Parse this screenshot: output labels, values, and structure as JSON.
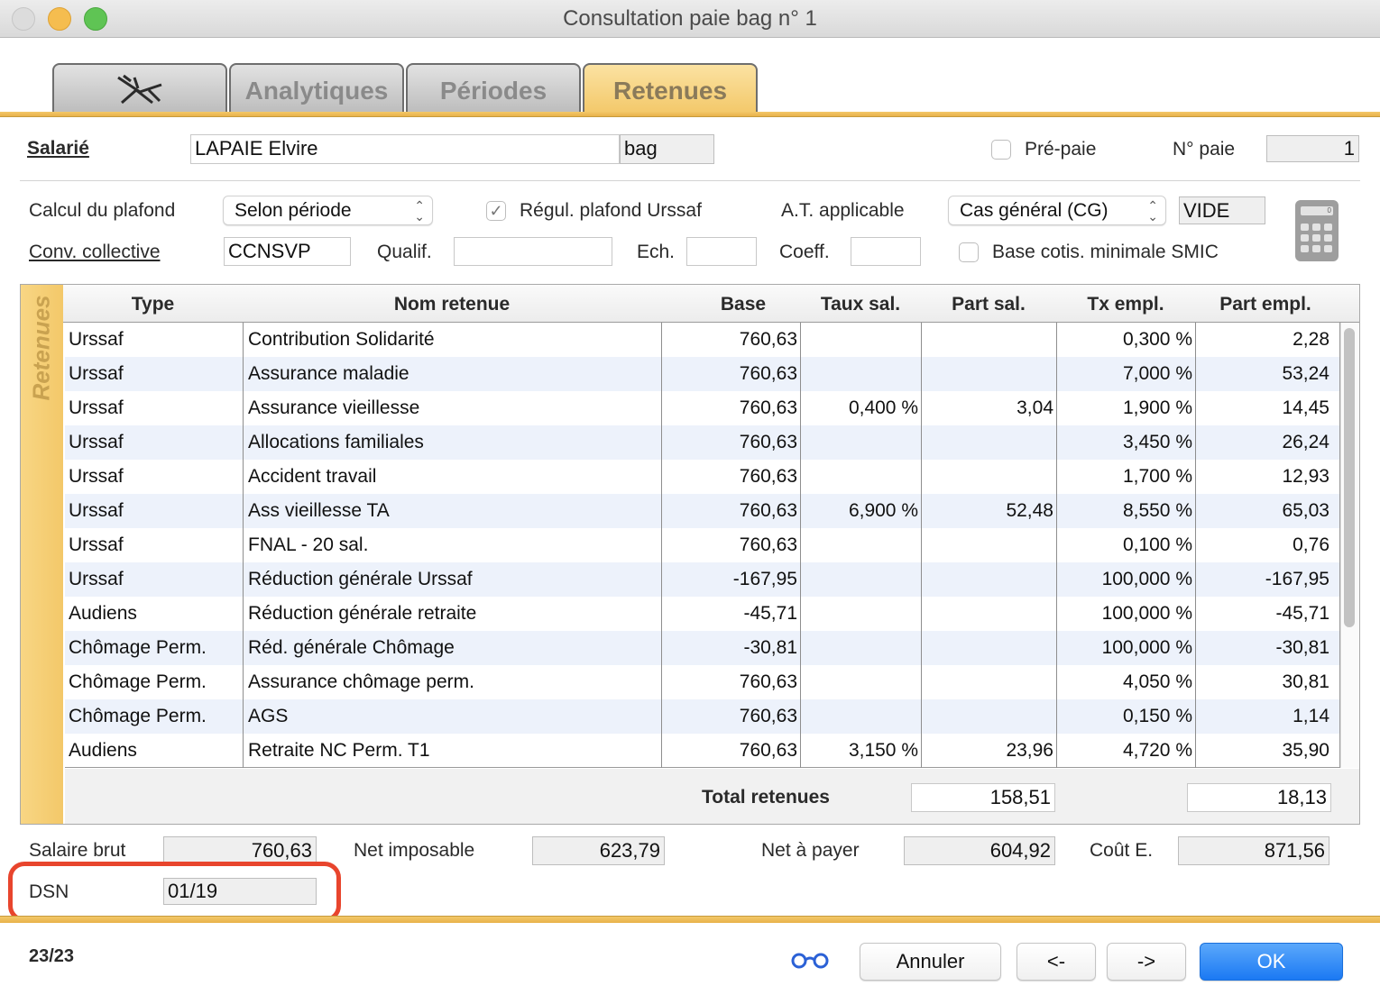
{
  "window": {
    "title": "Consultation paie bag n° 1"
  },
  "tabs": [
    {
      "icon": "beach-chair-icon"
    },
    {
      "label": "Analytiques"
    },
    {
      "label": "Périodes"
    },
    {
      "label": "Retenues",
      "active": true
    }
  ],
  "header": {
    "salarie_label": "Salarié",
    "salarie_name": "LAPAIE Elvire",
    "salarie_code": "bag",
    "prepaie_label": "Pré-paie",
    "npaie_label": "N° paie",
    "npaie_value": "1"
  },
  "params": {
    "calcul_plafond_label": "Calcul du plafond",
    "calcul_plafond_value": "Selon période",
    "regul_label": "Régul. plafond Urssaf",
    "at_label": "A.T. applicable",
    "at_value": "Cas général (CG)",
    "at_extra": "VIDE",
    "conv_label": "Conv. collective",
    "conv_value": "CCNSVP",
    "qualif_label": "Qualif.",
    "qualif_value": "",
    "ech_label": "Ech.",
    "ech_value": "",
    "coeff_label": "Coeff.",
    "coeff_value": "",
    "base_smic_label": "Base cotis. minimale SMIC",
    "calculator_icon": "calculator-icon"
  },
  "table": {
    "side_label": "Retenues",
    "columns": [
      "Type",
      "Nom retenue",
      "Base",
      "Taux sal.",
      "Part sal.",
      "Tx empl.",
      "Part empl."
    ],
    "rows": [
      {
        "type": "Urssaf",
        "nom": "Contribution Solidarité",
        "base": "760,63",
        "taux_sal": "",
        "part_sal": "",
        "tx_empl": "0,300 %",
        "part_empl": "2,28"
      },
      {
        "type": "Urssaf",
        "nom": "Assurance maladie",
        "base": "760,63",
        "taux_sal": "",
        "part_sal": "",
        "tx_empl": "7,000 %",
        "part_empl": "53,24"
      },
      {
        "type": "Urssaf",
        "nom": "Assurance vieillesse",
        "base": "760,63",
        "taux_sal": "0,400 %",
        "part_sal": "3,04",
        "tx_empl": "1,900 %",
        "part_empl": "14,45"
      },
      {
        "type": "Urssaf",
        "nom": "Allocations familiales",
        "base": "760,63",
        "taux_sal": "",
        "part_sal": "",
        "tx_empl": "3,450 %",
        "part_empl": "26,24"
      },
      {
        "type": "Urssaf",
        "nom": "Accident travail",
        "base": "760,63",
        "taux_sal": "",
        "part_sal": "",
        "tx_empl": "1,700 %",
        "part_empl": "12,93"
      },
      {
        "type": "Urssaf",
        "nom": "Ass vieillesse TA",
        "base": "760,63",
        "taux_sal": "6,900 %",
        "part_sal": "52,48",
        "tx_empl": "8,550 %",
        "part_empl": "65,03"
      },
      {
        "type": "Urssaf",
        "nom": "FNAL - 20 sal.",
        "base": "760,63",
        "taux_sal": "",
        "part_sal": "",
        "tx_empl": "0,100 %",
        "part_empl": "0,76"
      },
      {
        "type": "Urssaf",
        "nom": "Réduction générale Urssaf",
        "base": "-167,95",
        "taux_sal": "",
        "part_sal": "",
        "tx_empl": "100,000 %",
        "part_empl": "-167,95"
      },
      {
        "type": "Audiens",
        "nom": "Réduction générale retraite",
        "base": "-45,71",
        "taux_sal": "",
        "part_sal": "",
        "tx_empl": "100,000 %",
        "part_empl": "-45,71"
      },
      {
        "type": "Chômage Perm.",
        "nom": "Réd. générale Chômage",
        "base": "-30,81",
        "taux_sal": "",
        "part_sal": "",
        "tx_empl": "100,000 %",
        "part_empl": "-30,81"
      },
      {
        "type": "Chômage Perm.",
        "nom": "Assurance chômage perm.",
        "base": "760,63",
        "taux_sal": "",
        "part_sal": "",
        "tx_empl": "4,050 %",
        "part_empl": "30,81"
      },
      {
        "type": "Chômage Perm.",
        "nom": "AGS",
        "base": "760,63",
        "taux_sal": "",
        "part_sal": "",
        "tx_empl": "0,150 %",
        "part_empl": "1,14"
      },
      {
        "type": "Audiens",
        "nom": "Retraite NC Perm. T1",
        "base": "760,63",
        "taux_sal": "3,150 %",
        "part_sal": "23,96",
        "tx_empl": "4,720 %",
        "part_empl": "35,90"
      }
    ],
    "total_label": "Total retenues",
    "total_sal": "158,51",
    "total_empl": "18,13"
  },
  "summary": {
    "salaire_brut_label": "Salaire brut",
    "salaire_brut": "760,63",
    "net_imposable_label": "Net imposable",
    "net_imposable": "623,79",
    "net_payer_label": "Net à payer",
    "net_payer": "604,92",
    "cout_label": "Coût E.",
    "cout": "871,56",
    "dsn_label": "DSN",
    "dsn_value": "01/19"
  },
  "footer": {
    "record_counter": "23/23",
    "glasses_icon": "glasses-icon",
    "annuler": "Annuler",
    "prev": "<-",
    "next": "->",
    "ok": "OK"
  },
  "colors": {
    "accent_tab": "#f3c869",
    "row_alt": "#edf2fb",
    "ok_button": "#1b79f3",
    "highlight": "#e8452d"
  }
}
